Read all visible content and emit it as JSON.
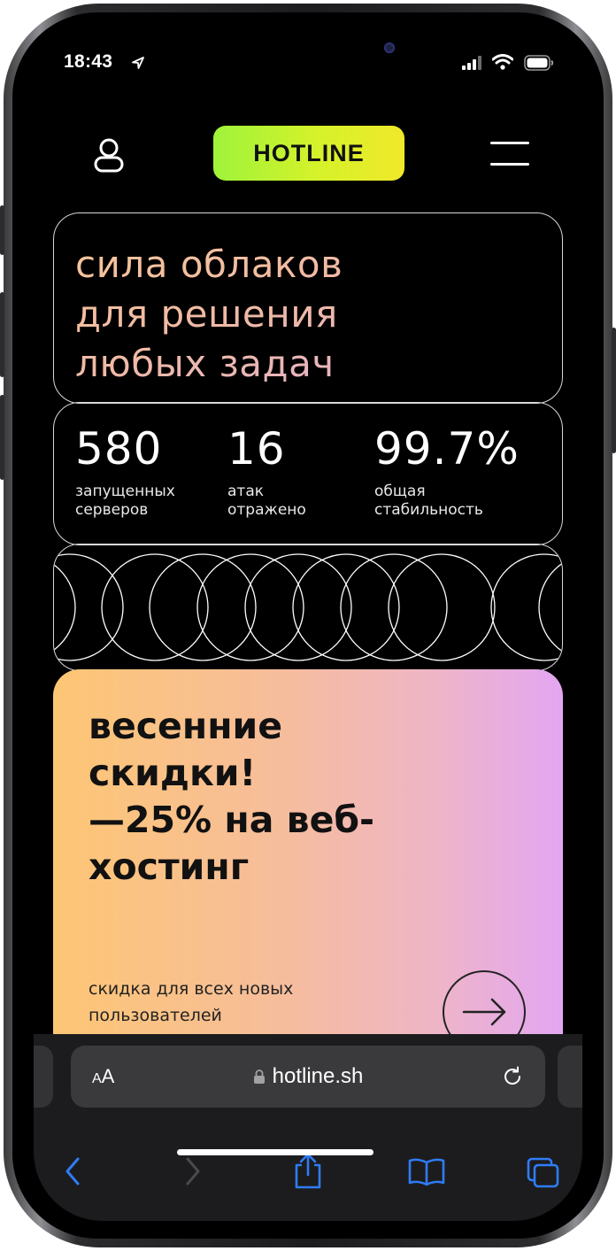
{
  "status": {
    "time": "18:43"
  },
  "header": {
    "logo": "HOTLINE"
  },
  "hero": {
    "line1": "сила облаков",
    "line2": "для решения",
    "line3": "любых задач"
  },
  "stats": [
    {
      "value": "580",
      "label": "запущенных серверов"
    },
    {
      "value": "16",
      "label": "атак отражено"
    },
    {
      "value": "99.7%",
      "label": "общая стабильность"
    }
  ],
  "promo": {
    "title": "весенние\nскидки!\n—25% на веб-\nхостинг",
    "subtitle": "скидка для всех новых пользователей"
  },
  "safari": {
    "text_size_label_small": "A",
    "text_size_label_large": "A",
    "url": "hotline.sh"
  },
  "colors": {
    "logo_accent": "#c8f22d",
    "promo_start": "#fdc674",
    "promo_end": "#e3a6f2",
    "ios_blue": "#2f7cf6"
  },
  "icons": [
    "location-arrow-icon",
    "signal-icon",
    "wifi-icon",
    "battery-icon",
    "user-icon",
    "menu-icon",
    "arrow-right-icon",
    "lock-icon",
    "reload-icon",
    "back-icon",
    "forward-icon",
    "share-icon",
    "bookmarks-icon",
    "tabs-icon"
  ]
}
